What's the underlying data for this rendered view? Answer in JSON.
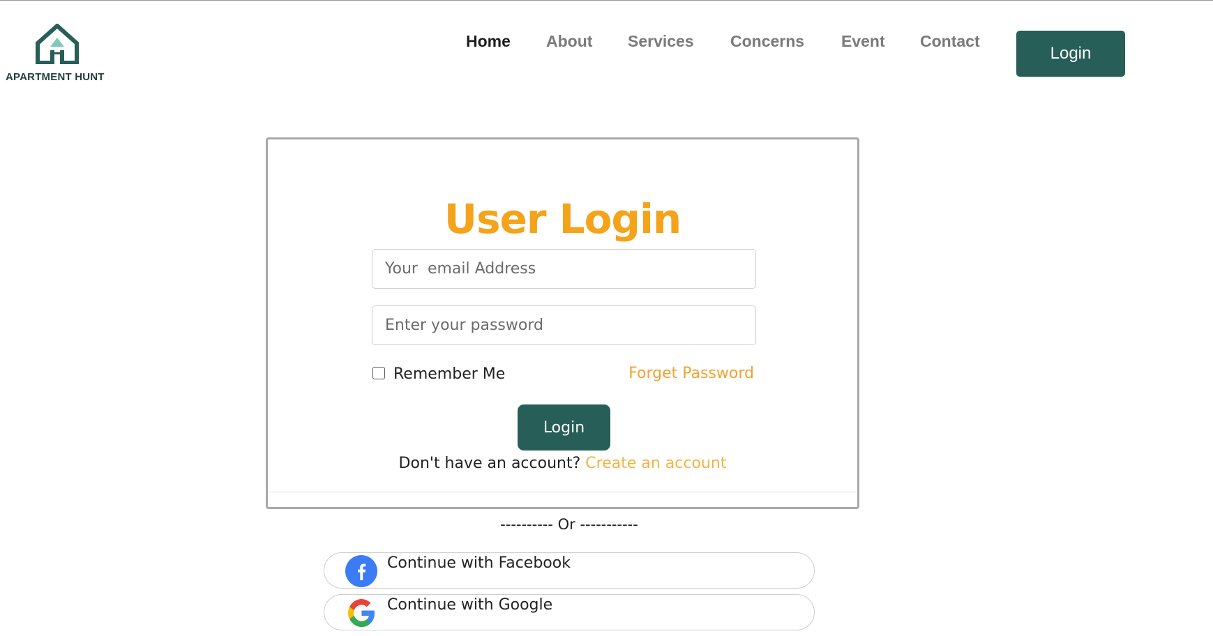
{
  "brand": {
    "name": "APARTMENT HUNT",
    "color": "#275e57",
    "accent": "#f4a31a"
  },
  "nav": {
    "items": [
      {
        "label": "Home",
        "active": true
      },
      {
        "label": "About",
        "active": false
      },
      {
        "label": "Services",
        "active": false
      },
      {
        "label": "Concerns",
        "active": false
      },
      {
        "label": "Event",
        "active": false
      },
      {
        "label": "Contact",
        "active": false
      }
    ],
    "login_label": "Login"
  },
  "login_card": {
    "title": "User Login",
    "email_placeholder": "Your  email Address",
    "password_placeholder": "Enter your password",
    "remember_label": "Remember Me",
    "remember_checked": false,
    "forget_label": "Forget Password",
    "submit_label": "Login",
    "signup_prompt": "Don't have an account?",
    "signup_link": "Create an account"
  },
  "divider": {
    "text": "---------- Or -----------"
  },
  "social": {
    "facebook_label": "Continue with Facebook",
    "facebook_icon": "facebook-icon",
    "google_label": "Continue with Google",
    "google_icon": "google-icon"
  }
}
